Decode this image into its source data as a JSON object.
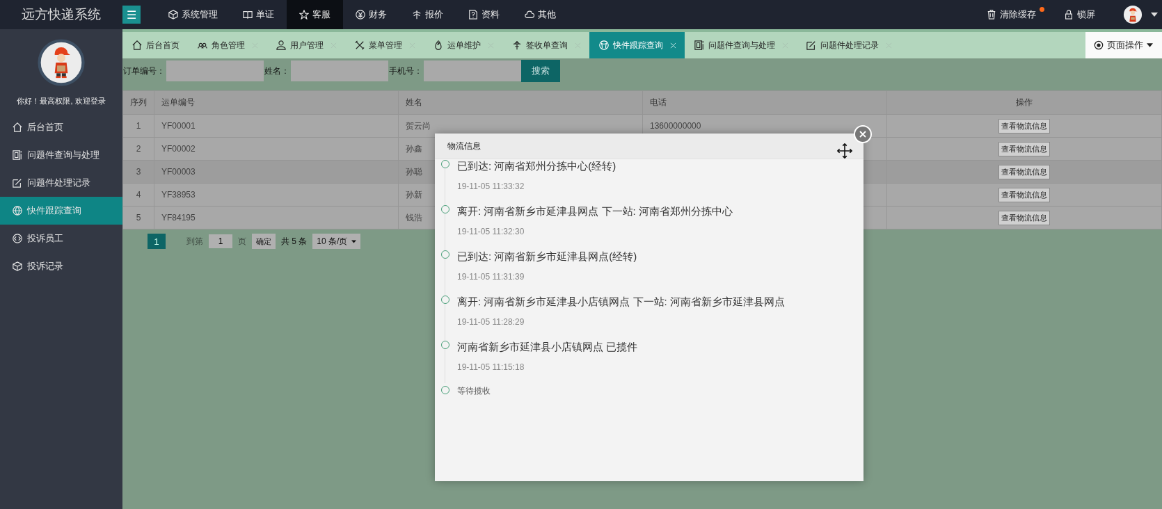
{
  "header": {
    "logo": "远方快递系统",
    "menu_icon": "☰",
    "nav": [
      {
        "label": "系统管理",
        "selected": false
      },
      {
        "label": "单证",
        "selected": false
      },
      {
        "label": "客服",
        "selected": true
      },
      {
        "label": "财务",
        "selected": false
      },
      {
        "label": "报价",
        "selected": false
      },
      {
        "label": "资料",
        "selected": false
      },
      {
        "label": "其他",
        "selected": false
      }
    ],
    "clear_cache": {
      "label": "清除缓存",
      "notify": true
    },
    "lock": "锁屏"
  },
  "sidebar": {
    "greeting": "你好！最高权限, 欢迎登录",
    "items": [
      {
        "label": "后台首页",
        "selected": false
      },
      {
        "label": "问题件查询与处理",
        "selected": false
      },
      {
        "label": "问题件处理记录",
        "selected": false
      },
      {
        "label": "快件跟踪查询",
        "selected": true
      },
      {
        "label": "投诉员工",
        "selected": false
      },
      {
        "label": "投诉记录",
        "selected": false
      }
    ]
  },
  "tabs": [
    {
      "label": "后台首页",
      "closable": false,
      "selected": false
    },
    {
      "label": "角色管理",
      "closable": true,
      "selected": false
    },
    {
      "label": "用户管理",
      "closable": true,
      "selected": false
    },
    {
      "label": "菜单管理",
      "closable": true,
      "selected": false
    },
    {
      "label": "运单维护",
      "closable": true,
      "selected": false
    },
    {
      "label": "签收单查询",
      "closable": true,
      "selected": false
    },
    {
      "label": "快件跟踪查询",
      "closable": true,
      "selected": true
    },
    {
      "label": "问题件查询与处理",
      "closable": true,
      "selected": false
    },
    {
      "label": "问题件处理记录",
      "closable": true,
      "selected": false
    }
  ],
  "page_actions": "页面操作",
  "search": {
    "fields": [
      {
        "label": "订单编号："
      },
      {
        "label": "姓名："
      },
      {
        "label": "手机号："
      }
    ],
    "button": "搜索"
  },
  "table": {
    "columns": [
      "序列",
      "运单编号",
      "姓名",
      "电话",
      "操作"
    ],
    "rows": [
      {
        "cells": [
          "1",
          "YF00001",
          "贺云尚",
          "13600000000"
        ],
        "action": "查看物流信息"
      },
      {
        "cells": [
          "2",
          "YF00002",
          "孙鑫",
          ""
        ],
        "action": "查看物流信息"
      },
      {
        "cells": [
          "3",
          "YF00003",
          "孙聪",
          ""
        ],
        "action": "查看物流信息"
      },
      {
        "cells": [
          "4",
          "YF38953",
          "孙新",
          ""
        ],
        "action": "查看物流信息"
      },
      {
        "cells": [
          "5",
          "YF84195",
          "钱浩",
          ""
        ],
        "action": "查看物流信息"
      }
    ]
  },
  "pagination": {
    "current": "1",
    "goto_label": "到第",
    "page_input": "1",
    "page_unit": "页",
    "confirm": "确定",
    "total": "共 5 条",
    "page_size": "10 条/页"
  },
  "modal": {
    "title": "物流信息",
    "entries": [
      {
        "kind": "event",
        "text": "已到达: 河南省郑州分拣中心(经转)",
        "time": "19-11-05 11:33:32"
      },
      {
        "kind": "event",
        "text": "离开: 河南省新乡市延津县网点 下一站: 河南省郑州分拣中心",
        "time": "19-11-05 11:32:30"
      },
      {
        "kind": "event",
        "text": "已到达: 河南省新乡市延津县网点(经转)",
        "time": "19-11-05 11:31:39"
      },
      {
        "kind": "event",
        "text": "离开: 河南省新乡市延津县小店镇网点 下一站: 河南省新乡市延津县网点",
        "time": "19-11-05 11:28:29"
      },
      {
        "kind": "event",
        "text": "河南省新乡市延津县小店镇网点 已揽件",
        "time": "19-11-05 11:15:18"
      },
      {
        "kind": "waiting",
        "text": "等待揽收"
      }
    ]
  }
}
